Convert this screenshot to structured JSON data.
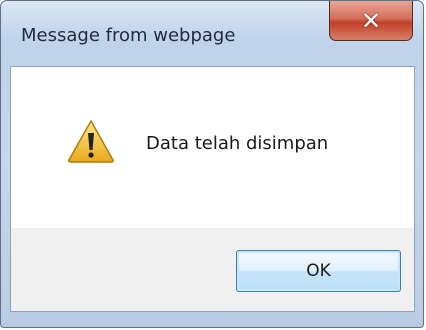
{
  "window": {
    "title": "Message from webpage",
    "close_glyph": "✕"
  },
  "dialog": {
    "icon": "warning-icon",
    "message": "Data telah disimpan"
  },
  "buttons": {
    "ok_label": "OK"
  },
  "colors": {
    "close_button": "#c9472f",
    "ok_border": "#3c7fb1",
    "warning_fill": "#f7c948"
  }
}
